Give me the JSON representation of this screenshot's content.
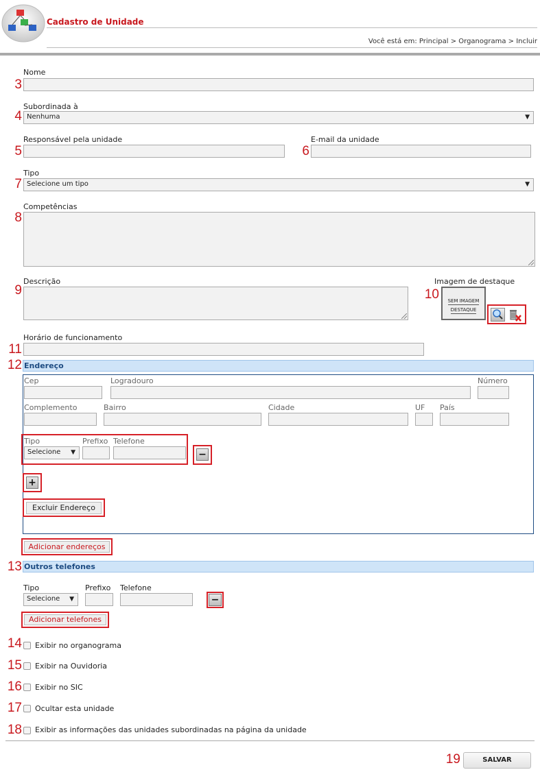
{
  "header": {
    "title": "Cadastro de Unidade",
    "breadcrumb": "Você está em: Principal > Organograma > Incluir"
  },
  "markers": [
    "3",
    "4",
    "5",
    "6",
    "7",
    "8",
    "9",
    "10",
    "11",
    "12",
    "13",
    "14",
    "15",
    "16",
    "17",
    "18",
    "19"
  ],
  "form": {
    "nome_label": "Nome",
    "subordinada_label": "Subordinada à",
    "subordinada_value": "Nenhuma",
    "responsavel_label": "Responsável pela unidade",
    "email_label": "E-mail da unidade",
    "tipo_label": "Tipo",
    "tipo_value": "Selecione um tipo",
    "competencias_label": "Competências",
    "descricao_label": "Descrição",
    "imagem_label": "Imagem de destaque",
    "imagem_placeholder_1": "SEM IMAGEM",
    "imagem_placeholder_2": "DESTAQUE",
    "horario_label": "Horário de funcionamento"
  },
  "endereco": {
    "section_title": "Endereço",
    "cep_label": "Cep",
    "logradouro_label": "Logradouro",
    "numero_label": "Número",
    "complemento_label": "Complemento",
    "bairro_label": "Bairro",
    "cidade_label": "Cidade",
    "uf_label": "UF",
    "pais_label": "País",
    "fone_tipo_label": "Tipo",
    "fone_tipo_value": "Selecione",
    "prefixo_label": "Prefixo",
    "telefone_label": "Telefone",
    "minus": "−",
    "plus": "+",
    "excluir_label": "Excluir Endereço",
    "adicionar_label": "Adicionar endereços"
  },
  "outros": {
    "section_title": "Outros telefones",
    "tipo_label": "Tipo",
    "tipo_value": "Selecione",
    "prefixo_label": "Prefixo",
    "telefone_label": "Telefone",
    "minus": "−",
    "adicionar_label": "Adicionar telefones"
  },
  "checkboxes": [
    {
      "label": "Exibir no organograma"
    },
    {
      "label": "Exibir na Ouvidoria"
    },
    {
      "label": "Exibir no SIC"
    },
    {
      "label": "Ocultar esta unidade"
    },
    {
      "label": "Exibir as informações das unidades subordinadas na página da unidade"
    }
  ],
  "salvar_label": "SALVAR",
  "colors": {
    "accent_red": "#c8181e",
    "section_blue": "#cfe4f8",
    "section_text": "#1d4b82"
  }
}
